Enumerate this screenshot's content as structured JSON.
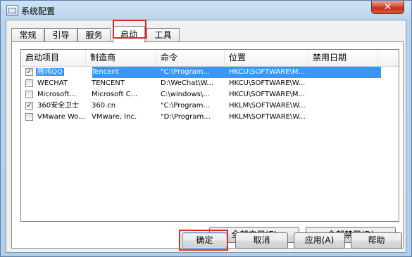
{
  "window": {
    "title": "系统配置",
    "close_label": "✕"
  },
  "tabs": [
    {
      "label": "常规"
    },
    {
      "label": "引导"
    },
    {
      "label": "服务"
    },
    {
      "label": "启动"
    },
    {
      "label": "工具"
    }
  ],
  "startup_list": {
    "columns": [
      "启动项目",
      "制造商",
      "命令",
      "位置",
      "禁用日期"
    ],
    "rows": [
      {
        "checked": true,
        "item": "腾讯QQ",
        "manufacturer": "Tencent",
        "command": "\"C:\\Program...",
        "location": "HKCU\\SOFTWARE\\M...",
        "disabled_date": ""
      },
      {
        "checked": false,
        "item": "WECHAT",
        "manufacturer": "TENCENT",
        "command": "D:\\WeChat\\W...",
        "location": "HKCU\\SOFTWARE\\W...",
        "disabled_date": ""
      },
      {
        "checked": false,
        "item": "Microsoft...",
        "manufacturer": "Microsoft C...",
        "command": "C:\\windows\\...",
        "location": "HKCU\\SOFTWARE\\M...",
        "disabled_date": ""
      },
      {
        "checked": true,
        "item": "360安全卫士",
        "manufacturer": "360.cn",
        "command": "\"C:\\Program...",
        "location": "HKLM\\SOFTWARE\\W...",
        "disabled_date": ""
      },
      {
        "checked": false,
        "item": "VMware Wo...",
        "manufacturer": "VMware, Inc.",
        "command": "\"D:\\Program...",
        "location": "HKLM\\SOFTWARE\\W...",
        "disabled_date": ""
      }
    ]
  },
  "panel_buttons": {
    "enable_all": "全部启用(E)",
    "disable_all": "全部禁用(D)"
  },
  "dialog_buttons": {
    "ok": "确定",
    "cancel": "取消",
    "apply": "应用(A)",
    "help": "帮助"
  },
  "highlight_color": "#e0262b",
  "selection_color": "#3399ff"
}
